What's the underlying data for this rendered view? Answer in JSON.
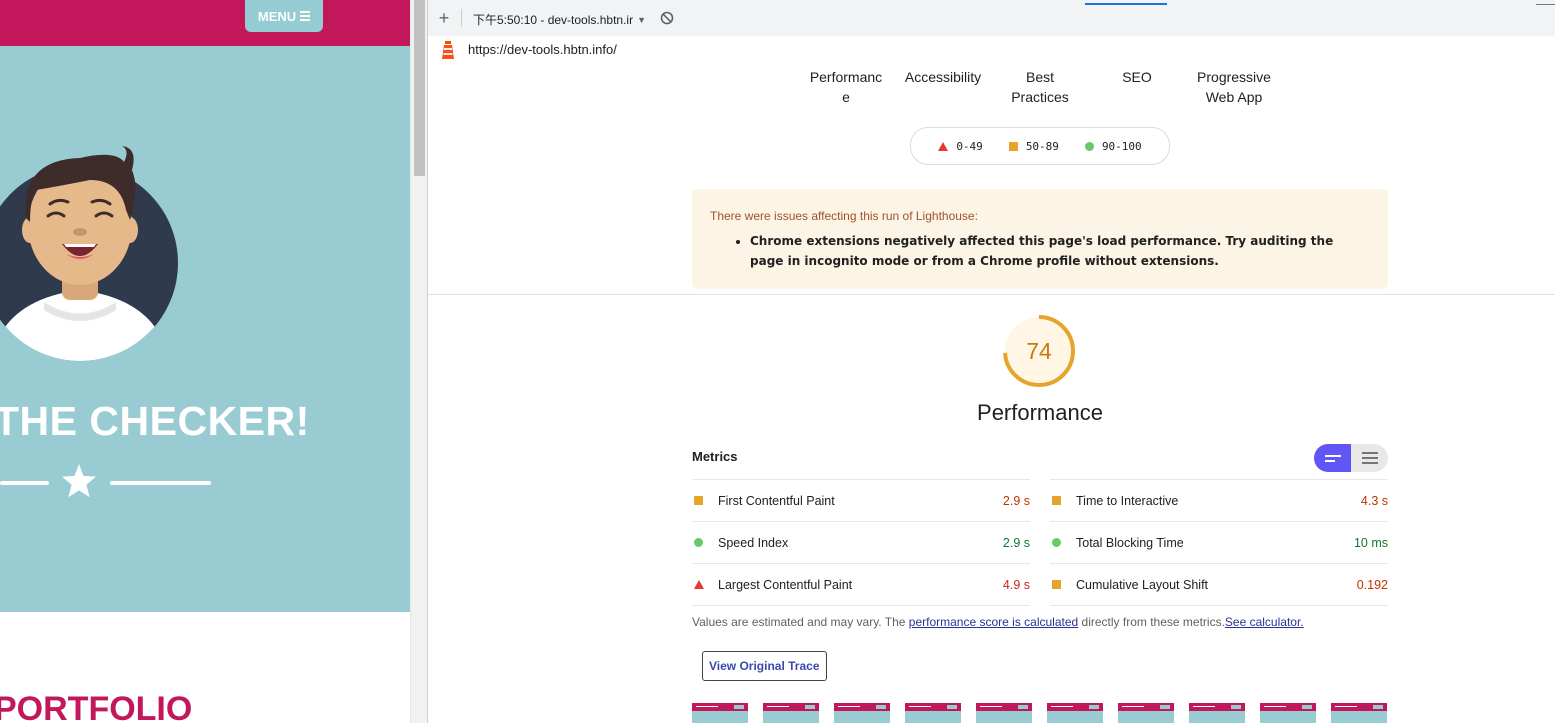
{
  "site": {
    "menu_label": "MENU",
    "hero_title": "THE CHECKER!",
    "portfolio_title": "PORTFOLIO",
    "colors": {
      "primary": "#c2185b",
      "hero_bg": "#98ccd2",
      "avatar_circle": "#2f3a4d"
    }
  },
  "devtools": {
    "report_select": "下午5:50:10 - dev-tools.hbtn.ir",
    "url": "https://dev-tools.hbtn.info/",
    "icons": {
      "add": "plus-icon",
      "clear": "block-icon",
      "brand": "lighthouse-icon"
    }
  },
  "report": {
    "categories": [
      "Performance",
      "Accessibility",
      "Best Practices",
      "SEO",
      "Progressive Web App"
    ],
    "legend": [
      {
        "range": "0-49",
        "shape": "triangle",
        "color": "#e53935"
      },
      {
        "range": "50-89",
        "shape": "square",
        "color": "#e6a42b"
      },
      {
        "range": "90-100",
        "shape": "circle",
        "color": "#66c96a"
      }
    ],
    "warning": {
      "title": "There were issues affecting this run of Lighthouse:",
      "items": [
        "Chrome extensions negatively affected this page's load performance. Try auditing the page in incognito mode or from a Chrome profile without extensions."
      ]
    },
    "performance": {
      "score": "74",
      "score_fraction": 0.74,
      "title": "Performance",
      "color": "#e6a42b"
    },
    "metrics_header": "Metrics",
    "metrics_left": [
      {
        "name": "First Contentful Paint",
        "value": "2.9 s",
        "rating": "average"
      },
      {
        "name": "Speed Index",
        "value": "2.9 s",
        "rating": "pass"
      },
      {
        "name": "Largest Contentful Paint",
        "value": "4.9 s",
        "rating": "fail"
      }
    ],
    "metrics_right": [
      {
        "name": "Time to Interactive",
        "value": "4.3 s",
        "rating": "average"
      },
      {
        "name": "Total Blocking Time",
        "value": "10 ms",
        "rating": "pass"
      },
      {
        "name": "Cumulative Layout Shift",
        "value": "0.192",
        "rating": "average"
      }
    ],
    "note": {
      "prefix": "Values are estimated and may vary. The ",
      "link1": "performance score is calculated",
      "middle": " directly from these metrics.",
      "link2": "See calculator."
    },
    "view_trace_label": "View Original Trace",
    "filmstrip_frames": 10
  }
}
